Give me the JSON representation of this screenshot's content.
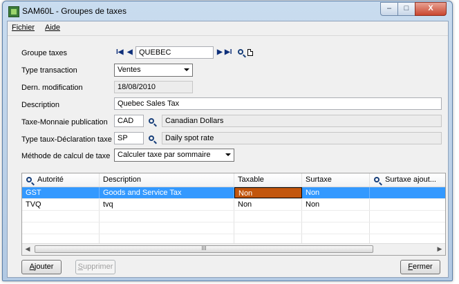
{
  "window": {
    "title": "SAM60L - Groupes de taxes"
  },
  "titlebar_buttons": {
    "minimize": "–",
    "maximize": "□",
    "close": "X"
  },
  "menu": {
    "items": [
      "Fichier",
      "Aide"
    ]
  },
  "form": {
    "groupe_taxes": {
      "label": "Groupe taxes",
      "value": "QUEBEC"
    },
    "type_transaction": {
      "label": "Type transaction",
      "value": "Ventes"
    },
    "dern_modification": {
      "label": "Dern. modification",
      "value": "18/08/2010"
    },
    "description": {
      "label": "Description",
      "value": "Quebec Sales Tax"
    },
    "taxe_monnaie": {
      "label": "Taxe-Monnaie publication",
      "code": "CAD",
      "name": "Canadian Dollars"
    },
    "type_taux": {
      "label": "Type taux-Déclaration taxe",
      "code": "SP",
      "name": "Daily spot rate"
    },
    "methode_calcul": {
      "label": "Méthode de calcul de taxe",
      "value": "Calculer taxe par sommaire"
    }
  },
  "nav": {
    "first": "I◀",
    "prev": "◀",
    "next": "▶",
    "last": "▶I"
  },
  "grid": {
    "columns": [
      "Autorité",
      "Description",
      "Taxable",
      "Surtaxe",
      "Surtaxe ajout..."
    ],
    "rows": [
      {
        "autorite": "GST",
        "description": "Goods and Service Tax",
        "taxable": "Non",
        "surtaxe": "Non",
        "surtaxe_ajout": ""
      },
      {
        "autorite": "TVQ",
        "description": "tvq",
        "taxable": "Non",
        "surtaxe": "Non",
        "surtaxe_ajout": ""
      }
    ],
    "scroll": {
      "left": "◀",
      "right": "▶",
      "grip": "III"
    }
  },
  "buttons": {
    "ajouter": "Ajouter",
    "supprimer": "Supprimer",
    "fermer": "Fermer"
  },
  "colors": {
    "selection": "#3399ff",
    "focused_cell": "#c2560d"
  }
}
